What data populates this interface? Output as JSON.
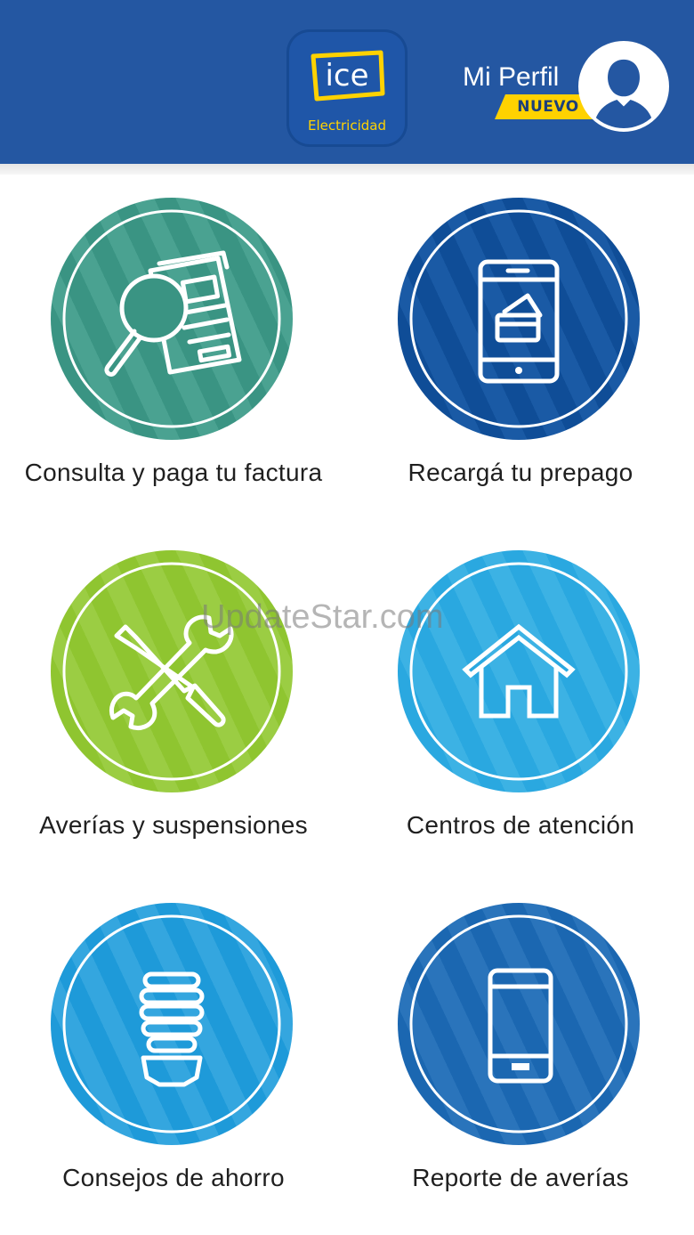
{
  "header": {
    "logo": {
      "mark": "ice",
      "subtitle": "Electricidad",
      "colors": {
        "mark": "#ffd200",
        "background": "#1f56a8"
      }
    },
    "profile": {
      "label": "Mi Perfil",
      "badge": "NUEVO",
      "icon": "user-avatar-icon"
    },
    "background_color": "#2457a2"
  },
  "menu": {
    "items": [
      {
        "label": "Consulta y paga tu factura",
        "icon": "invoice-search-icon",
        "color": "#3a9483"
      },
      {
        "label": "Recargá tu prepago",
        "icon": "mobile-payment-icon",
        "color": "#0f4d97"
      },
      {
        "label": "Averías y suspensiones",
        "icon": "tools-icon",
        "color": "#8fc530"
      },
      {
        "label": "Centros de atención",
        "icon": "home-icon",
        "color": "#2aa8e0"
      },
      {
        "label": "Consejos de ahorro",
        "icon": "lightbulb-icon",
        "color": "#1e9ad9"
      },
      {
        "label": "Reporte de averías",
        "icon": "smartphone-icon",
        "color": "#1b67b1"
      }
    ]
  },
  "watermark": "UpdateStar.com"
}
